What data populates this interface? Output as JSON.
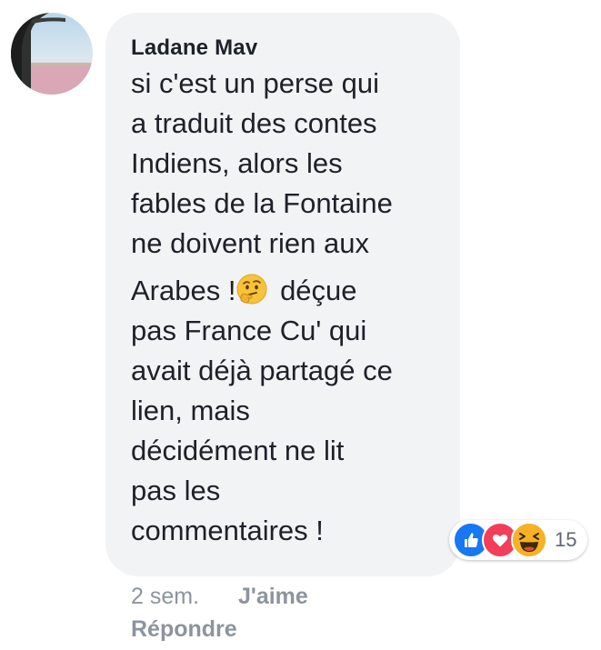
{
  "comment": {
    "author": "Ladane Mav",
    "lines_part1": [
      "si c'est un perse qui",
      "a traduit des contes",
      "Indiens, alors les",
      "fables de la Fontaine",
      "ne doivent rien aux"
    ],
    "line_with_emoji_before": "Arabes !",
    "emoji_icon": "thinking-face-icon",
    "line_with_emoji_after": " déçue",
    "lines_part2": [
      "pas France Cu' qui",
      "avait déjà partagé ce",
      "lien, mais",
      "décidément ne lit",
      "pas les",
      "commentaires !"
    ]
  },
  "reactions": {
    "icons": [
      "like-icon",
      "love-icon",
      "haha-icon"
    ],
    "count": "15",
    "colors": {
      "like": "#1877f2",
      "love": "#f33e58",
      "haha": "#f7b125"
    }
  },
  "meta": {
    "time": "2 sem.",
    "like_label": "J'aime",
    "reply_label": "Répondre"
  },
  "colors": {
    "bubble_bg": "#f2f3f5",
    "text": "#1d2129",
    "meta_text": "#8d949e"
  }
}
